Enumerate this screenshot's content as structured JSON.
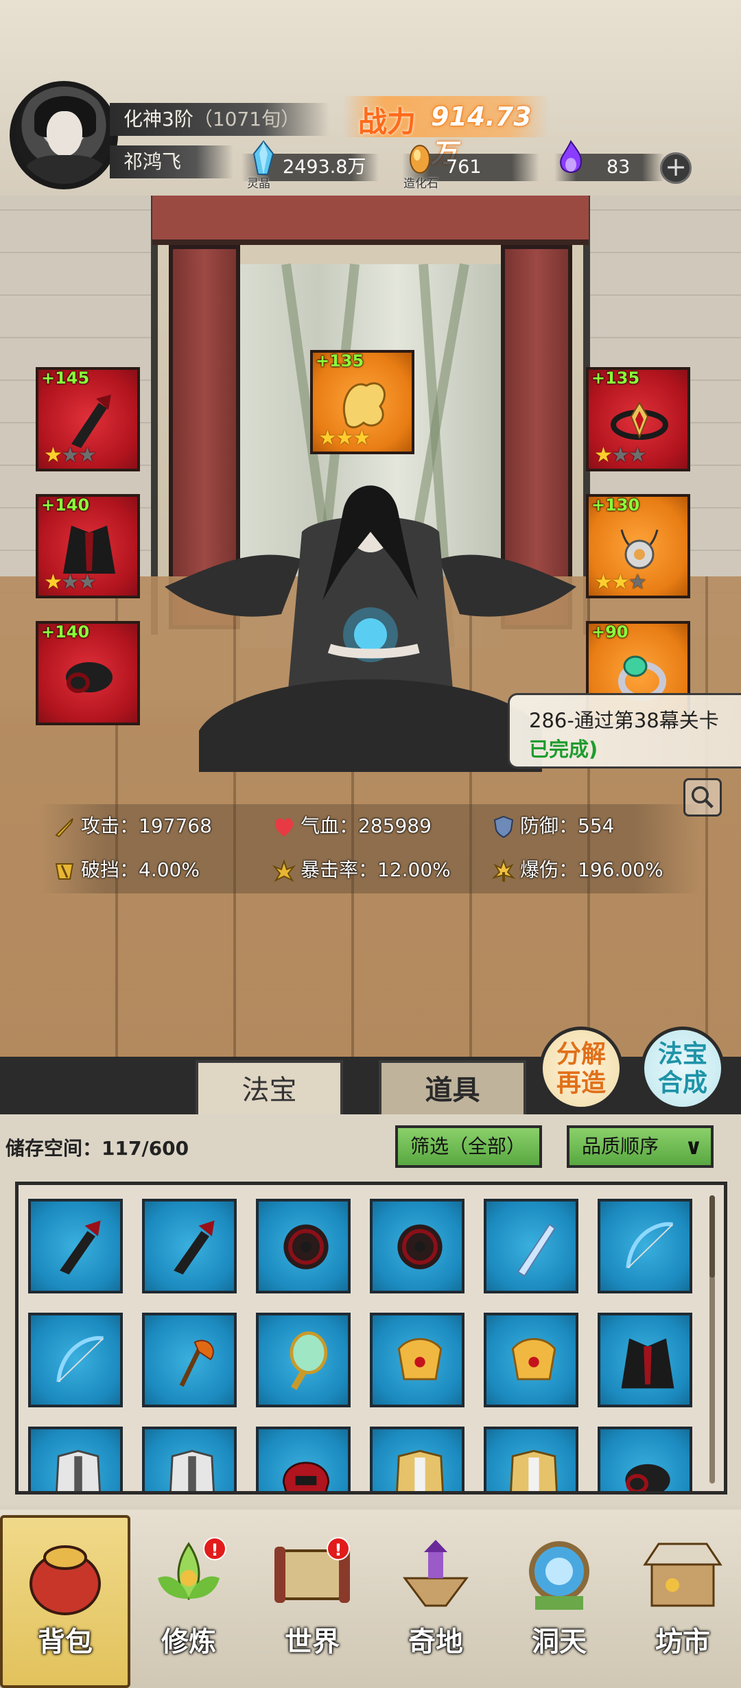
{
  "player": {
    "realm": "化神3阶",
    "age": "（1071旬）",
    "name": "祁鸿飞",
    "power_label": "战力",
    "power_value": "914.73万"
  },
  "resources": [
    {
      "icon": "spirit-crystal-icon",
      "caption": "灵晶",
      "value": "2493.8万"
    },
    {
      "icon": "creation-stone-icon",
      "caption": "造化石",
      "value": "761"
    },
    {
      "icon": "purple-flame-icon",
      "caption": "",
      "value": "83"
    }
  ],
  "equipment": {
    "left": [
      {
        "level": "+145",
        "stars": 1,
        "color": "red",
        "icon": "dark-blade-icon"
      },
      {
        "level": "+140",
        "stars": 1,
        "color": "red",
        "icon": "dark-robe-icon"
      },
      {
        "level": "+140",
        "stars": 0,
        "color": "red",
        "icon": "shadow-bracer-icon"
      }
    ],
    "center": {
      "level": "+135",
      "stars": 3,
      "color": "orange",
      "icon": "golden-beast-icon"
    },
    "right": [
      {
        "level": "+135",
        "stars": 1,
        "color": "red",
        "icon": "crimson-circlet-icon"
      },
      {
        "level": "+130",
        "stars": 2,
        "color": "orange",
        "icon": "silver-pendant-icon"
      },
      {
        "level": "+90",
        "stars": 0,
        "color": "orange",
        "icon": "jade-ring-icon"
      }
    ]
  },
  "quest": {
    "line1": "286-通过第38幕关卡",
    "line2": "已完成)"
  },
  "stats": [
    {
      "icon": "sword-icon",
      "label": "攻击：",
      "value": "197768"
    },
    {
      "icon": "heart-icon",
      "label": "气血：",
      "value": "285989"
    },
    {
      "icon": "shield-icon",
      "label": "防御：",
      "value": "554"
    },
    {
      "icon": "break-guard-icon",
      "label": "破挡：",
      "value": "4.00%"
    },
    {
      "icon": "crit-rate-icon",
      "label": "暴击率：",
      "value": "12.00%"
    },
    {
      "icon": "crit-damage-icon",
      "label": "爆伤：",
      "value": "196.00%"
    }
  ],
  "tabs": {
    "fabao": "法宝",
    "daoju": "道具"
  },
  "round_buttons": {
    "decompose": [
      "分解",
      "再造"
    ],
    "synth": [
      "法宝",
      "合成"
    ]
  },
  "inventory": {
    "capacity_label": "储存空间：",
    "capacity_value": "117/600",
    "filter_label": "筛选（全部）",
    "sort_label": "品质顺序",
    "items": [
      "dark-blade-icon",
      "dark-blade-icon",
      "spiked-wheel-icon",
      "spiked-wheel-icon",
      "ice-sword-icon",
      "ice-bow-icon",
      "ice-bow-icon",
      "fire-axe-icon",
      "jade-mirror-icon",
      "golden-mask-icon",
      "golden-mask-icon",
      "dark-robe-icon",
      "white-armor-icon",
      "white-armor-icon",
      "crimson-helm-icon",
      "gold-armor-icon",
      "gold-armor-icon",
      "shadow-bracer-icon"
    ]
  },
  "nav": [
    {
      "label": "背包",
      "icon": "bag-icon",
      "badge": false,
      "active": true
    },
    {
      "label": "修炼",
      "icon": "lotus-icon",
      "badge": true,
      "active": false
    },
    {
      "label": "世界",
      "icon": "scroll-map-icon",
      "badge": true,
      "active": false
    },
    {
      "label": "奇地",
      "icon": "floating-island-icon",
      "badge": false,
      "active": false
    },
    {
      "label": "洞天",
      "icon": "portal-icon",
      "badge": false,
      "active": false
    },
    {
      "label": "坊市",
      "icon": "market-stall-icon",
      "badge": false,
      "active": false
    }
  ],
  "colors": {
    "slot_red": "#c41a24",
    "slot_orange": "#e87d14",
    "item_blue": "#1c8bc0",
    "level_green": "#8cff3a",
    "quest_done": "#1d9c2e"
  }
}
